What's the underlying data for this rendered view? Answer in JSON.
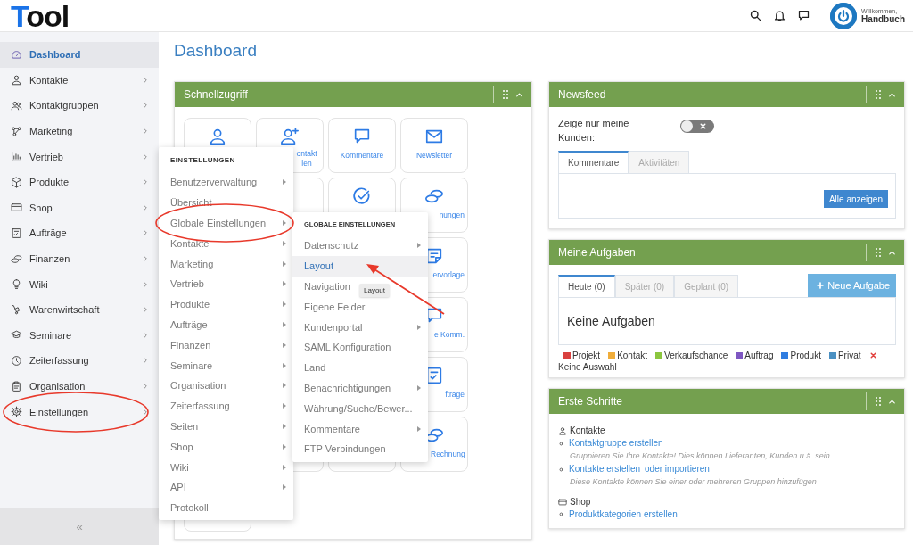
{
  "header": {
    "logo": {
      "accent": "T",
      "rest": "ool"
    },
    "greeting": "Willkommen,",
    "user": "Handbuch"
  },
  "sidebar": {
    "items": [
      {
        "label": "Dashboard",
        "selected": true,
        "has_submenu": false
      },
      {
        "label": "Kontakte",
        "selected": false,
        "has_submenu": true
      },
      {
        "label": "Kontaktgruppen",
        "selected": false,
        "has_submenu": true
      },
      {
        "label": "Marketing",
        "selected": false,
        "has_submenu": true
      },
      {
        "label": "Vertrieb",
        "selected": false,
        "has_submenu": true
      },
      {
        "label": "Produkte",
        "selected": false,
        "has_submenu": true
      },
      {
        "label": "Shop",
        "selected": false,
        "has_submenu": true
      },
      {
        "label": "Aufträge",
        "selected": false,
        "has_submenu": true
      },
      {
        "label": "Finanzen",
        "selected": false,
        "has_submenu": true
      },
      {
        "label": "Wiki",
        "selected": false,
        "has_submenu": true
      },
      {
        "label": "Warenwirtschaft",
        "selected": false,
        "has_submenu": true
      },
      {
        "label": "Seminare",
        "selected": false,
        "has_submenu": true
      },
      {
        "label": "Zeiterfassung",
        "selected": false,
        "has_submenu": true
      },
      {
        "label": "Organisation",
        "selected": false,
        "has_submenu": true
      },
      {
        "label": "Einstellungen",
        "selected": false,
        "has_submenu": true
      }
    ],
    "collapse": "«"
  },
  "page_title": "Dashboard",
  "quick_access": {
    "title": "Schnellzugriff",
    "tile_labels": [
      "ontakt len",
      "Kommentare",
      "Newsletter",
      "nungen",
      "ervorlage",
      "e Komm.",
      "fträge",
      "Rechnung"
    ]
  },
  "newsfeed": {
    "title": "Newsfeed",
    "filter_label": "Zeige nur meine Kunden:",
    "filter_on": false,
    "tabs": [
      {
        "label": "Kommentare",
        "selected": true
      },
      {
        "label": "Aktivitäten",
        "selected": false
      }
    ],
    "button": "Alle anzeigen"
  },
  "tasks": {
    "title": "Meine Aufgaben",
    "tabs": [
      {
        "label": "Heute (0)",
        "selected": true
      },
      {
        "label": "Später (0)",
        "selected": false
      },
      {
        "label": "Geplant (0)",
        "selected": false
      }
    ],
    "new_button": "Neue Aufgabe",
    "empty_text": "Keine Aufgaben",
    "legend": [
      {
        "label": "Projekt",
        "color": "#d9413f"
      },
      {
        "label": "Kontakt",
        "color": "#f0ad3a"
      },
      {
        "label": "Verkaufschance",
        "color": "#8cc63f"
      },
      {
        "label": "Auftrag",
        "color": "#7e57c2"
      },
      {
        "label": "Produkt",
        "color": "#2f7de1"
      },
      {
        "label": "Privat",
        "color": "#4a90c2"
      }
    ],
    "clear_label": "Keine Auswahl"
  },
  "first_steps": {
    "title": "Erste Schritte",
    "sections": [
      {
        "title": "Kontakte",
        "items": [
          {
            "links": [
              "Kontaktgruppe erstellen"
            ],
            "description": "Gruppieren Sie Ihre Kontakte! Dies können Lieferanten, Kunden u.ä. sein"
          },
          {
            "links": [
              "Kontakte erstellen",
              "oder importieren"
            ],
            "description": "Diese Kontakte können Sie einer oder mehreren Gruppen hinzufügen"
          }
        ]
      },
      {
        "title": "Shop",
        "items": [
          {
            "links": [
              "Produktkategorien erstellen"
            ]
          }
        ]
      }
    ]
  },
  "settings_menu": {
    "title": "EINSTELLUNGEN",
    "items": [
      {
        "label": "Benutzerverwaltung",
        "has_submenu": true
      },
      {
        "label": "Übersicht",
        "has_submenu": false
      },
      {
        "label": "Globale Einstellungen",
        "has_submenu": true
      },
      {
        "label": "Kontakte",
        "has_submenu": true
      },
      {
        "label": "Marketing",
        "has_submenu": true
      },
      {
        "label": "Vertrieb",
        "has_submenu": true
      },
      {
        "label": "Produkte",
        "has_submenu": true
      },
      {
        "label": "Aufträge",
        "has_submenu": true
      },
      {
        "label": "Finanzen",
        "has_submenu": true
      },
      {
        "label": "Seminare",
        "has_submenu": true
      },
      {
        "label": "Organisation",
        "has_submenu": true
      },
      {
        "label": "Zeiterfassung",
        "has_submenu": true
      },
      {
        "label": "Seiten",
        "has_submenu": true
      },
      {
        "label": "Shop",
        "has_submenu": true
      },
      {
        "label": "Wiki",
        "has_submenu": true
      },
      {
        "label": "API",
        "has_submenu": true
      },
      {
        "label": "Protokoll",
        "has_submenu": false
      }
    ]
  },
  "submenu": {
    "title": "GLOBALE EINSTELLUNGEN",
    "items": [
      {
        "label": "Datenschutz",
        "has_submenu": true,
        "selected": false
      },
      {
        "label": "Layout",
        "has_submenu": false,
        "selected": true
      },
      {
        "label": "Navigation",
        "has_submenu": false,
        "selected": false
      },
      {
        "label": "Eigene Felder",
        "has_submenu": false,
        "selected": false
      },
      {
        "label": "Kundenportal",
        "has_submenu": true,
        "selected": false
      },
      {
        "label": "SAML Konfiguration",
        "has_submenu": false,
        "selected": false
      },
      {
        "label": "Land",
        "has_submenu": false,
        "selected": false
      },
      {
        "label": "Benachrichtigungen",
        "has_submenu": true,
        "selected": false
      },
      {
        "label": "Währung/Suche/Bewer...",
        "has_submenu": false,
        "selected": false
      },
      {
        "label": "Kommentare",
        "has_submenu": true,
        "selected": false
      },
      {
        "label": "FTP Verbindungen",
        "has_submenu": false,
        "selected": false
      }
    ]
  },
  "tooltip": "Layout"
}
